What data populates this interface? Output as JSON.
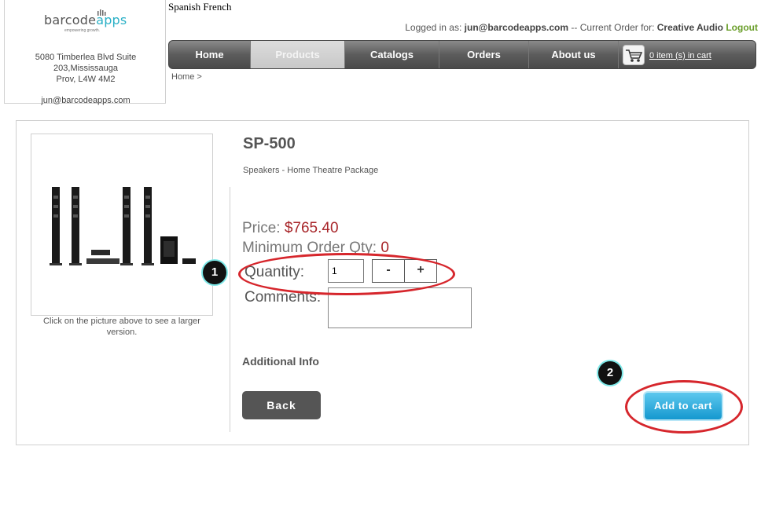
{
  "company": {
    "logo_text_a": "barcode",
    "logo_text_b": "apps",
    "logo_tagline": "empowering growth.",
    "address_lines": [
      "5080 Timberlea Blvd Suite",
      "203,Mississauga",
      "Prov, L4W 4M2"
    ],
    "email": "jun@barcodeapps.com"
  },
  "languages": "Spanish French",
  "login": {
    "prefix": "Logged in as: ",
    "user": "jun@barcodeapps.com",
    "separator": " -- Current Order for: ",
    "customer": "Creative Audio",
    "logout": "Logout"
  },
  "nav": {
    "items": [
      "Home",
      "Products",
      "Catalogs",
      "Orders",
      "About us"
    ],
    "active_index": 1,
    "cart_text": "0 item (s) in cart"
  },
  "breadcrumb": "Home >",
  "product": {
    "sku": "SP-500",
    "description": "Speakers - Home Theatre Package",
    "price_label": "Price: ",
    "price": "$765.40",
    "min_qty_label": "Minimum Order Qty: ",
    "min_qty": "0",
    "quantity_label": "Quantity:",
    "quantity_value": "1",
    "minus": "-",
    "plus": "+",
    "comments_label": "Comments:",
    "additional_info": "Additional Info",
    "image_caption": "Click on the picture above to see a larger version."
  },
  "buttons": {
    "back": "Back",
    "add_to_cart": "Add to cart"
  },
  "callouts": [
    "1",
    "2"
  ],
  "colors": {
    "price": "#a8262a",
    "callout_ring": "#d6262c",
    "add_button": "#1598cf",
    "logout": "#6a9e2a"
  }
}
